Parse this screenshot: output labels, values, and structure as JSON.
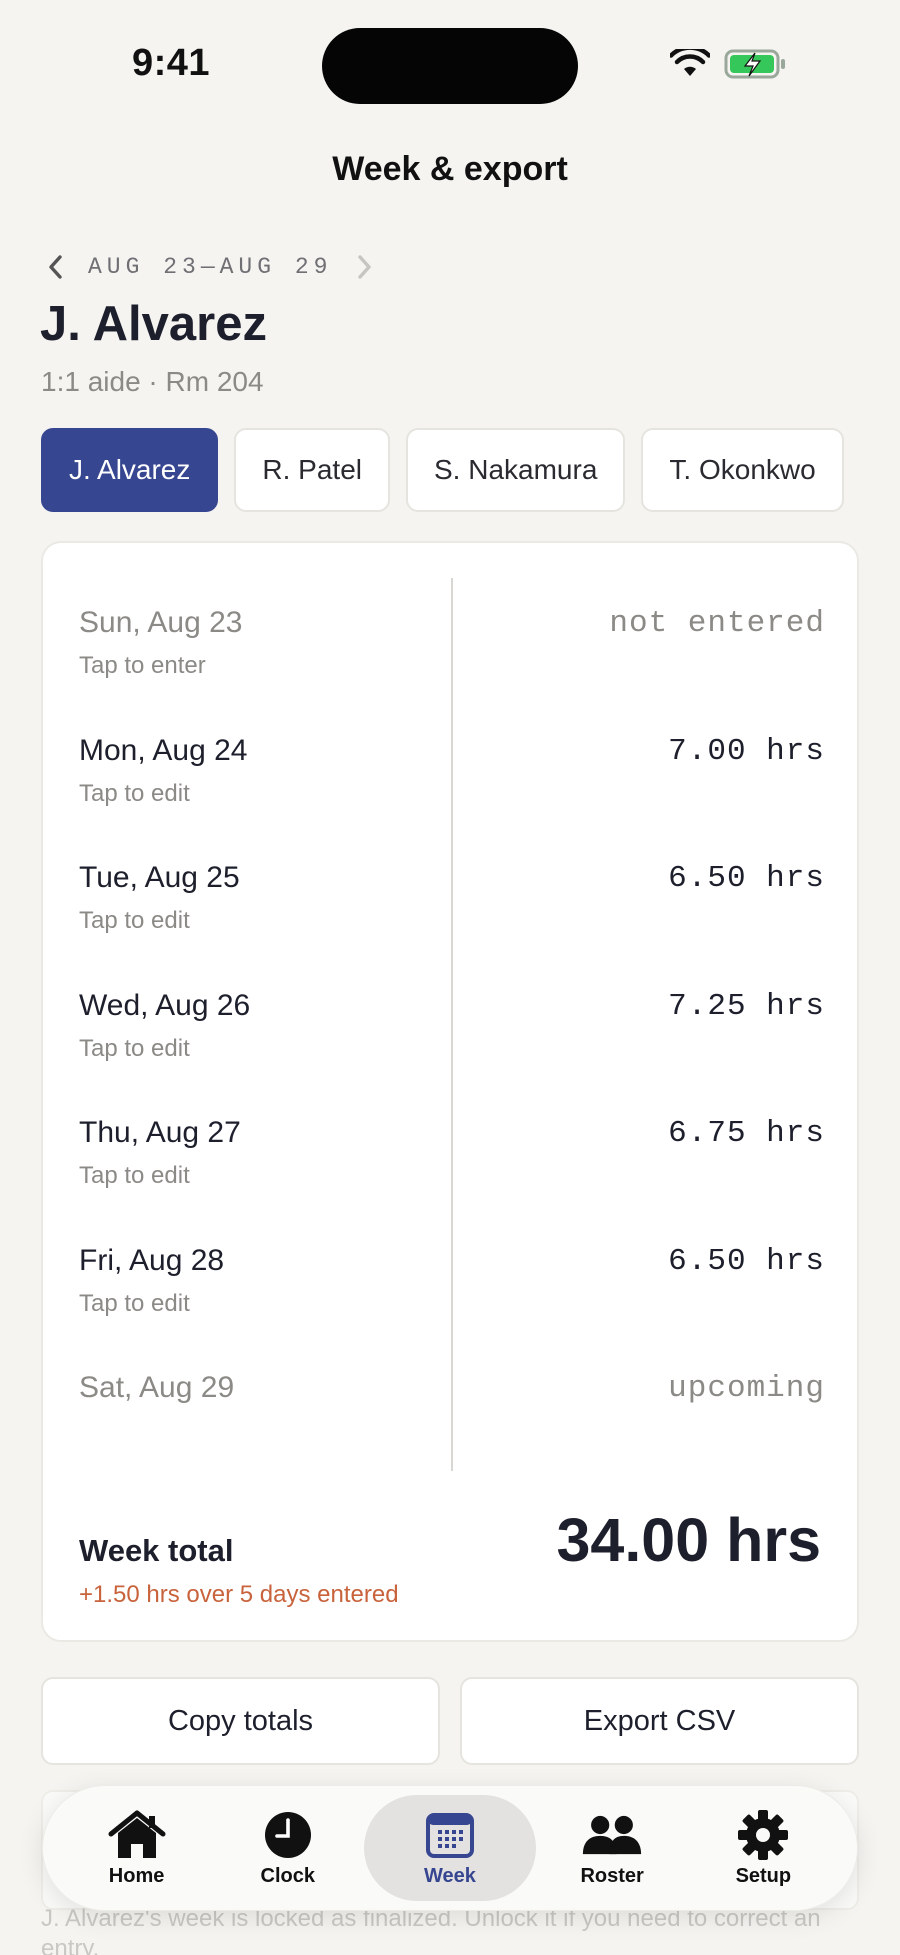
{
  "status_bar": {
    "time": "9:41",
    "icons": [
      "wifi-icon",
      "battery-charging-icon"
    ]
  },
  "header": {
    "title": "Week & export"
  },
  "week": {
    "range": "AUG 23—AUG 29"
  },
  "person": {
    "name": "J. Alvarez",
    "subtitle": "1:1 aide · Rm 204"
  },
  "people_tabs": [
    {
      "label": "J. Alvarez",
      "selected": true
    },
    {
      "label": "R. Patel",
      "selected": false
    },
    {
      "label": "S. Nakamura",
      "selected": false
    },
    {
      "label": "T. Okonkwo",
      "selected": false
    }
  ],
  "days": [
    {
      "day": "Sun, Aug 23",
      "hint": "Tap to enter",
      "value": "not entered",
      "muted": true
    },
    {
      "day": "Mon, Aug 24",
      "hint": "Tap to edit",
      "value": "7.00 hrs",
      "muted": false
    },
    {
      "day": "Tue, Aug 25",
      "hint": "Tap to edit",
      "value": "6.50 hrs",
      "muted": false
    },
    {
      "day": "Wed, Aug 26",
      "hint": "Tap to edit",
      "value": "7.25 hrs",
      "muted": false
    },
    {
      "day": "Thu, Aug 27",
      "hint": "Tap to edit",
      "value": "6.75 hrs",
      "muted": false
    },
    {
      "day": "Fri, Aug 28",
      "hint": "Tap to edit",
      "value": "6.50 hrs",
      "muted": false
    },
    {
      "day": "Sat, Aug 29",
      "hint": "",
      "value": "upcoming",
      "muted": true
    }
  ],
  "total": {
    "label": "Week total",
    "delta": "+1.50 hrs over 5 days entered",
    "value": "34.00 hrs"
  },
  "actions": {
    "copy": "Copy totals",
    "export": "Export CSV"
  },
  "lock_note": "J. Alvarez's week is locked as finalized. Unlock it if you need to correct an entry.",
  "tabbar": [
    {
      "label": "Home",
      "icon": "home-icon",
      "active": false
    },
    {
      "label": "Clock",
      "icon": "clock-icon",
      "active": false
    },
    {
      "label": "Week",
      "icon": "calendar-icon",
      "active": true
    },
    {
      "label": "Roster",
      "icon": "people-icon",
      "active": false
    },
    {
      "label": "Setup",
      "icon": "gear-icon",
      "active": false
    }
  ],
  "colors": {
    "accent": "#374690",
    "warning": "#c8633c",
    "battery": "#35c759"
  }
}
